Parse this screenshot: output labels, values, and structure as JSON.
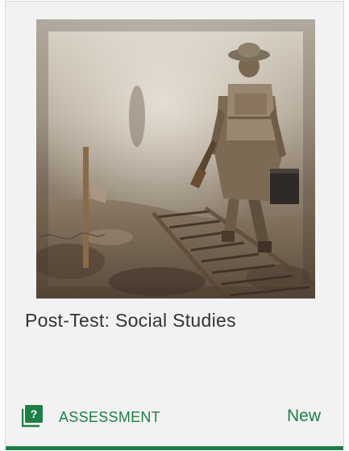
{
  "card": {
    "title": "Post-Test: Social Studies",
    "type_label": "ASSESSMENT",
    "type_icon": "question-book-icon",
    "status": "New",
    "thumbnail": "toy-soldier-walking-on-duckboards-photo",
    "accent_color": "#1e7f46"
  }
}
